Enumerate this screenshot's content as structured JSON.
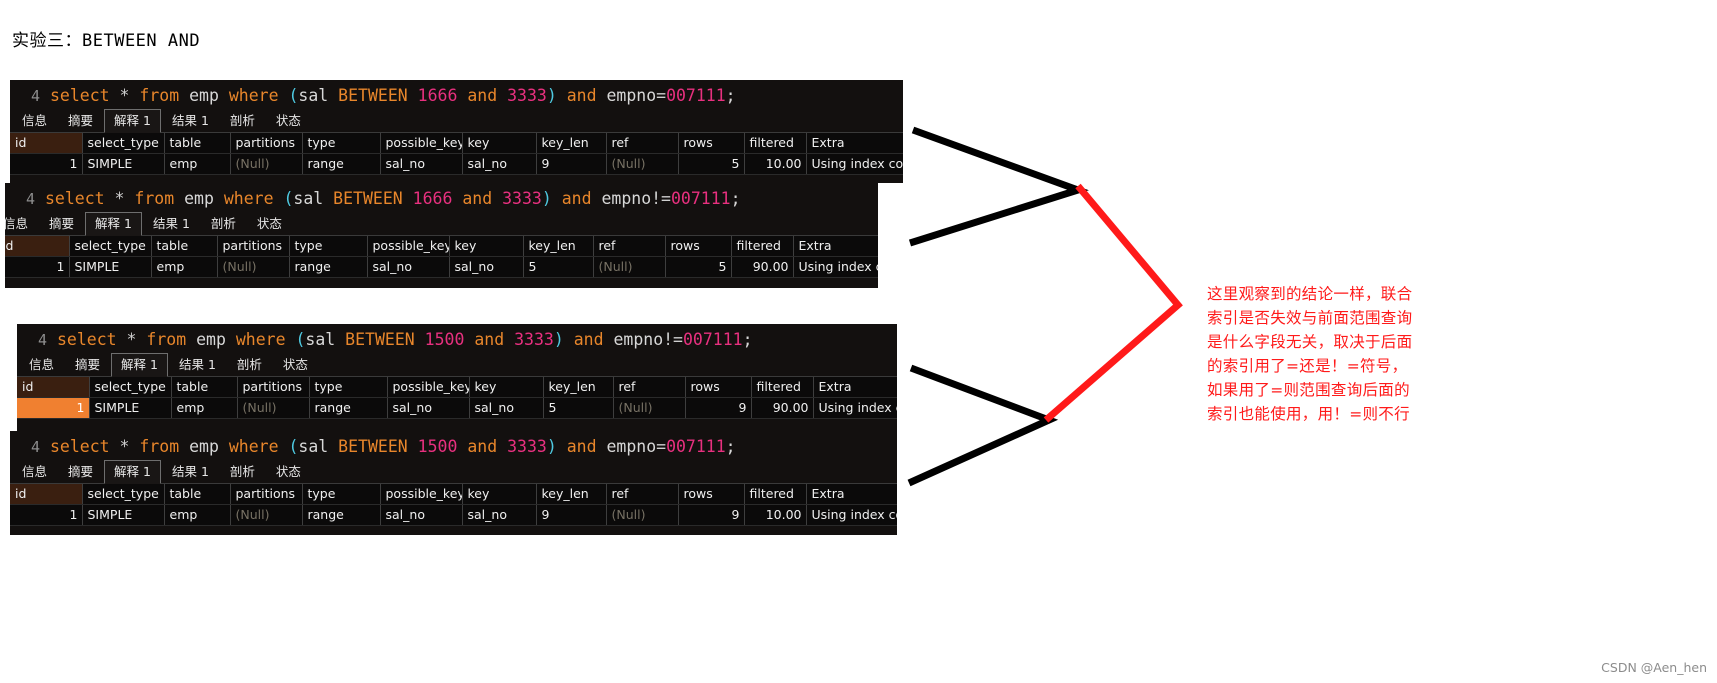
{
  "page": {
    "title": "实验三：BETWEEN AND",
    "watermark": "CSDN @Aen_hen",
    "annotation": "这里观察到的结论一样，联合索引是否失效与前面范围查询是什么字段无关，取决于后面的索引用了=还是！=符号，如果用了=则范围查询后面的索引也能使用，用！=则不行",
    "accent_red": "#ff1a1a",
    "connector_black": "#000000"
  },
  "tabs": [
    {
      "label": "信息",
      "active": false
    },
    {
      "label": "摘要",
      "active": false
    },
    {
      "label": "解释 1",
      "active": true
    },
    {
      "label": "结果 1",
      "active": false
    },
    {
      "label": "剖析",
      "active": false
    },
    {
      "label": "状态",
      "active": false
    }
  ],
  "columns": [
    "id",
    "select_type",
    "table",
    "partitions",
    "type",
    "possible_keys",
    "key",
    "key_len",
    "ref",
    "rows",
    "filtered",
    "Extra"
  ],
  "panels": [
    {
      "line_number": "4",
      "sql": {
        "kw1": "select",
        "star": "*",
        "kw2": "from",
        "tbl": "emp",
        "kw3": "where",
        "open": "(",
        "col": "sal",
        "between": "BETWEEN",
        "low": "1666",
        "and": "and",
        "high": "3333",
        "close": ")",
        "and2": "and",
        "col2": "empno",
        "op": "=",
        "val": "007111",
        "semi": ";"
      },
      "row": {
        "id": "1",
        "select_type": "SIMPLE",
        "table": "emp",
        "partitions": "(Null)",
        "type": "range",
        "possible_keys": "sal_no",
        "key": "sal_no",
        "key_len": "9",
        "ref": "(Null)",
        "rows": "5",
        "filtered": "10.00",
        "extra": "Using index cond"
      },
      "id_selected": false
    },
    {
      "line_number": "4",
      "sql": {
        "kw1": "select",
        "star": "*",
        "kw2": "from",
        "tbl": "emp",
        "kw3": "where",
        "open": "(",
        "col": "sal",
        "between": "BETWEEN",
        "low": "1666",
        "and": "and",
        "high": "3333",
        "close": ")",
        "and2": "and",
        "col2": "empno",
        "op": "!=",
        "val": "007111",
        "semi": ";"
      },
      "row": {
        "id": "1",
        "select_type": "SIMPLE",
        "table": "emp",
        "partitions": "(Null)",
        "type": "range",
        "possible_keys": "sal_no",
        "key": "sal_no",
        "key_len": "5",
        "ref": "(Null)",
        "rows": "5",
        "filtered": "90.00",
        "extra": "Using index cond"
      },
      "id_selected": false
    },
    {
      "line_number": "4",
      "sql": {
        "kw1": "select",
        "star": "*",
        "kw2": "from",
        "tbl": "emp",
        "kw3": "where",
        "open": "(",
        "col": "sal",
        "between": "BETWEEN",
        "low": "1500",
        "and": "and",
        "high": "3333",
        "close": ")",
        "and2": "and",
        "col2": "empno",
        "op": "!=",
        "val": "007111",
        "semi": ";"
      },
      "row": {
        "id": "1",
        "select_type": "SIMPLE",
        "table": "emp",
        "partitions": "(Null)",
        "type": "range",
        "possible_keys": "sal_no",
        "key": "sal_no",
        "key_len": "5",
        "ref": "(Null)",
        "rows": "9",
        "filtered": "90.00",
        "extra": "Using index cond"
      },
      "id_selected": true
    },
    {
      "line_number": "4",
      "sql": {
        "kw1": "select",
        "star": "*",
        "kw2": "from",
        "tbl": "emp",
        "kw3": "where",
        "open": "(",
        "col": "sal",
        "between": "BETWEEN",
        "low": "1500",
        "and": "and",
        "high": "3333",
        "close": ")",
        "and2": "and",
        "col2": "empno",
        "op": "=",
        "val": "007111",
        "semi": ";"
      },
      "row": {
        "id": "1",
        "select_type": "SIMPLE",
        "table": "emp",
        "partitions": "(Null)",
        "type": "range",
        "possible_keys": "sal_no",
        "key": "sal_no",
        "key_len": "9",
        "ref": "(Null)",
        "rows": "9",
        "filtered": "10.00",
        "extra": "Using index cond"
      },
      "id_selected": false
    }
  ]
}
